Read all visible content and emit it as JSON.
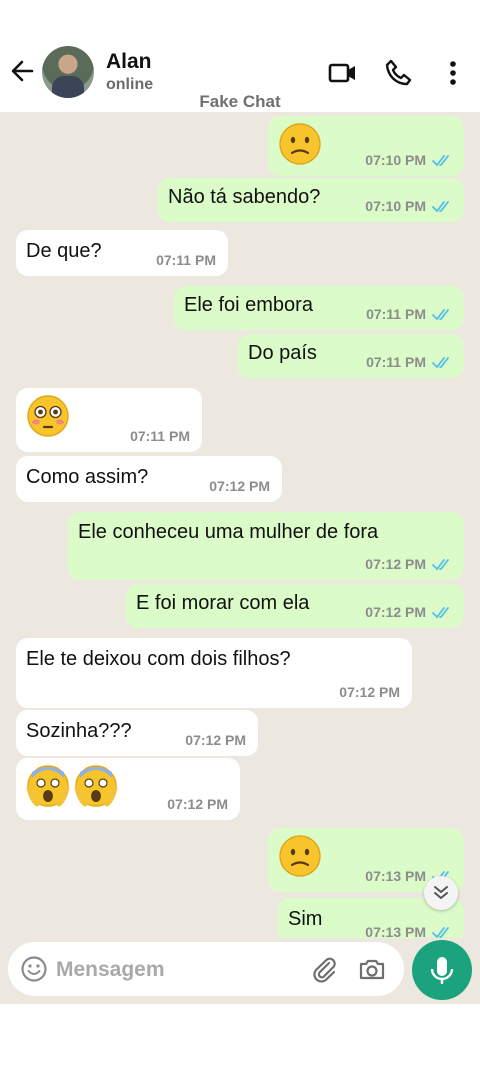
{
  "header": {
    "contact_name": "Alan",
    "status": "online",
    "watermark": "Fake Chat",
    "icons": [
      "back-arrow-icon",
      "video-call-icon",
      "phone-icon",
      "more-vertical-icon"
    ]
  },
  "messages": [
    {
      "dir": "out",
      "emoji": "confused",
      "time": "07:10 PM",
      "read": true
    },
    {
      "dir": "out",
      "text": "Não tá sabendo?",
      "time": "07:10 PM",
      "read": true
    },
    {
      "dir": "in",
      "text": "De que?",
      "time": "07:11 PM"
    },
    {
      "dir": "out",
      "text": "Ele foi embora",
      "time": "07:11 PM",
      "read": true
    },
    {
      "dir": "out",
      "text": "Do país",
      "time": "07:11 PM",
      "read": true
    },
    {
      "dir": "in",
      "emoji": "flushed",
      "time": "07:11 PM"
    },
    {
      "dir": "in",
      "text": "Como assim?",
      "time": "07:12 PM"
    },
    {
      "dir": "out",
      "text": "Ele conheceu uma mulher de fora",
      "time": "07:12 PM",
      "read": true
    },
    {
      "dir": "out",
      "text": "E foi morar com ela",
      "time": "07:12 PM",
      "read": true
    },
    {
      "dir": "in",
      "text": "Ele te deixou com dois filhos?",
      "time": "07:12 PM"
    },
    {
      "dir": "in",
      "text": "Sozinha???",
      "time": "07:12 PM"
    },
    {
      "dir": "in",
      "emoji": "screaming x2",
      "time": "07:12 PM"
    },
    {
      "dir": "out",
      "emoji": "confused",
      "time": "07:13 PM",
      "read": true
    },
    {
      "dir": "out",
      "text": "Sim",
      "time": "07:13 PM",
      "read": true
    }
  ],
  "composer": {
    "placeholder": "Mensagem",
    "icons": [
      "emoji-icon",
      "attach-icon",
      "camera-icon",
      "mic-icon"
    ]
  },
  "colors": {
    "outgoing_bubble": "#dbfbc8",
    "incoming_bubble": "#ffffff",
    "chat_background": "#ece8e0",
    "read_ticks": "#53bdeb",
    "mic_button": "#1aa37d"
  }
}
